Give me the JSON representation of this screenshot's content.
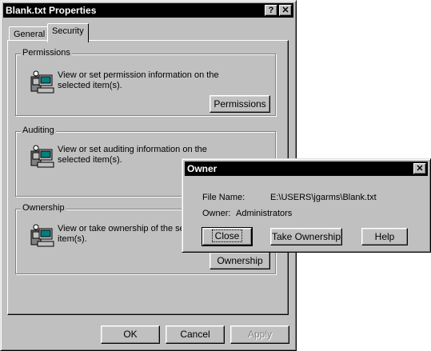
{
  "main_window": {
    "title": "Blank.txt Properties",
    "help_button": "?",
    "close_button": "✕",
    "tabs": [
      {
        "label": "General"
      },
      {
        "label": "Security"
      }
    ],
    "groups": {
      "permissions": {
        "legend": "Permissions",
        "description": "View or set permission information on the selected item(s).",
        "button": "Permissions",
        "icon": "user-computer-icon"
      },
      "auditing": {
        "legend": "Auditing",
        "description": "View or set auditing information on the selected item(s).",
        "icon": "user-computer-icon"
      },
      "ownership": {
        "legend": "Ownership",
        "description": "View or take ownership of the selected item(s).",
        "button": "Ownership",
        "icon": "user-computer-icon"
      }
    },
    "footer": {
      "ok": "OK",
      "cancel": "Cancel",
      "apply": "Apply"
    }
  },
  "owner_dialog": {
    "title": "Owner",
    "close_button": "✕",
    "file_name_label": "File Name:",
    "file_name_value": "E:\\USERS\\jgarms\\Blank.txt",
    "owner_label": "Owner:",
    "owner_value": "Administrators",
    "buttons": {
      "close": "Close",
      "take_ownership": "Take Ownership",
      "help": "Help"
    }
  }
}
